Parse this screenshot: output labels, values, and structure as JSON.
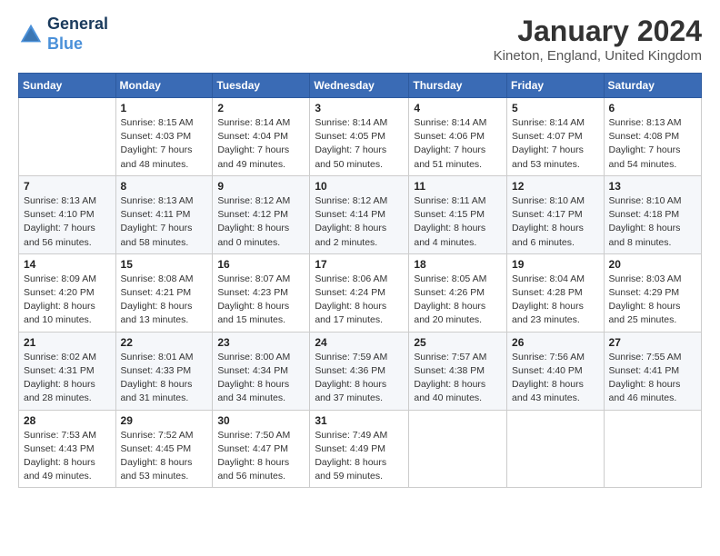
{
  "header": {
    "logo_line1": "General",
    "logo_line2": "Blue",
    "month_title": "January 2024",
    "location": "Kineton, England, United Kingdom"
  },
  "days_of_week": [
    "Sunday",
    "Monday",
    "Tuesday",
    "Wednesday",
    "Thursday",
    "Friday",
    "Saturday"
  ],
  "weeks": [
    [
      {
        "day": "",
        "info": ""
      },
      {
        "day": "1",
        "info": "Sunrise: 8:15 AM\nSunset: 4:03 PM\nDaylight: 7 hours\nand 48 minutes."
      },
      {
        "day": "2",
        "info": "Sunrise: 8:14 AM\nSunset: 4:04 PM\nDaylight: 7 hours\nand 49 minutes."
      },
      {
        "day": "3",
        "info": "Sunrise: 8:14 AM\nSunset: 4:05 PM\nDaylight: 7 hours\nand 50 minutes."
      },
      {
        "day": "4",
        "info": "Sunrise: 8:14 AM\nSunset: 4:06 PM\nDaylight: 7 hours\nand 51 minutes."
      },
      {
        "day": "5",
        "info": "Sunrise: 8:14 AM\nSunset: 4:07 PM\nDaylight: 7 hours\nand 53 minutes."
      },
      {
        "day": "6",
        "info": "Sunrise: 8:13 AM\nSunset: 4:08 PM\nDaylight: 7 hours\nand 54 minutes."
      }
    ],
    [
      {
        "day": "7",
        "info": "Sunrise: 8:13 AM\nSunset: 4:10 PM\nDaylight: 7 hours\nand 56 minutes."
      },
      {
        "day": "8",
        "info": "Sunrise: 8:13 AM\nSunset: 4:11 PM\nDaylight: 7 hours\nand 58 minutes."
      },
      {
        "day": "9",
        "info": "Sunrise: 8:12 AM\nSunset: 4:12 PM\nDaylight: 8 hours\nand 0 minutes."
      },
      {
        "day": "10",
        "info": "Sunrise: 8:12 AM\nSunset: 4:14 PM\nDaylight: 8 hours\nand 2 minutes."
      },
      {
        "day": "11",
        "info": "Sunrise: 8:11 AM\nSunset: 4:15 PM\nDaylight: 8 hours\nand 4 minutes."
      },
      {
        "day": "12",
        "info": "Sunrise: 8:10 AM\nSunset: 4:17 PM\nDaylight: 8 hours\nand 6 minutes."
      },
      {
        "day": "13",
        "info": "Sunrise: 8:10 AM\nSunset: 4:18 PM\nDaylight: 8 hours\nand 8 minutes."
      }
    ],
    [
      {
        "day": "14",
        "info": "Sunrise: 8:09 AM\nSunset: 4:20 PM\nDaylight: 8 hours\nand 10 minutes."
      },
      {
        "day": "15",
        "info": "Sunrise: 8:08 AM\nSunset: 4:21 PM\nDaylight: 8 hours\nand 13 minutes."
      },
      {
        "day": "16",
        "info": "Sunrise: 8:07 AM\nSunset: 4:23 PM\nDaylight: 8 hours\nand 15 minutes."
      },
      {
        "day": "17",
        "info": "Sunrise: 8:06 AM\nSunset: 4:24 PM\nDaylight: 8 hours\nand 17 minutes."
      },
      {
        "day": "18",
        "info": "Sunrise: 8:05 AM\nSunset: 4:26 PM\nDaylight: 8 hours\nand 20 minutes."
      },
      {
        "day": "19",
        "info": "Sunrise: 8:04 AM\nSunset: 4:28 PM\nDaylight: 8 hours\nand 23 minutes."
      },
      {
        "day": "20",
        "info": "Sunrise: 8:03 AM\nSunset: 4:29 PM\nDaylight: 8 hours\nand 25 minutes."
      }
    ],
    [
      {
        "day": "21",
        "info": "Sunrise: 8:02 AM\nSunset: 4:31 PM\nDaylight: 8 hours\nand 28 minutes."
      },
      {
        "day": "22",
        "info": "Sunrise: 8:01 AM\nSunset: 4:33 PM\nDaylight: 8 hours\nand 31 minutes."
      },
      {
        "day": "23",
        "info": "Sunrise: 8:00 AM\nSunset: 4:34 PM\nDaylight: 8 hours\nand 34 minutes."
      },
      {
        "day": "24",
        "info": "Sunrise: 7:59 AM\nSunset: 4:36 PM\nDaylight: 8 hours\nand 37 minutes."
      },
      {
        "day": "25",
        "info": "Sunrise: 7:57 AM\nSunset: 4:38 PM\nDaylight: 8 hours\nand 40 minutes."
      },
      {
        "day": "26",
        "info": "Sunrise: 7:56 AM\nSunset: 4:40 PM\nDaylight: 8 hours\nand 43 minutes."
      },
      {
        "day": "27",
        "info": "Sunrise: 7:55 AM\nSunset: 4:41 PM\nDaylight: 8 hours\nand 46 minutes."
      }
    ],
    [
      {
        "day": "28",
        "info": "Sunrise: 7:53 AM\nSunset: 4:43 PM\nDaylight: 8 hours\nand 49 minutes."
      },
      {
        "day": "29",
        "info": "Sunrise: 7:52 AM\nSunset: 4:45 PM\nDaylight: 8 hours\nand 53 minutes."
      },
      {
        "day": "30",
        "info": "Sunrise: 7:50 AM\nSunset: 4:47 PM\nDaylight: 8 hours\nand 56 minutes."
      },
      {
        "day": "31",
        "info": "Sunrise: 7:49 AM\nSunset: 4:49 PM\nDaylight: 8 hours\nand 59 minutes."
      },
      {
        "day": "",
        "info": ""
      },
      {
        "day": "",
        "info": ""
      },
      {
        "day": "",
        "info": ""
      }
    ]
  ]
}
